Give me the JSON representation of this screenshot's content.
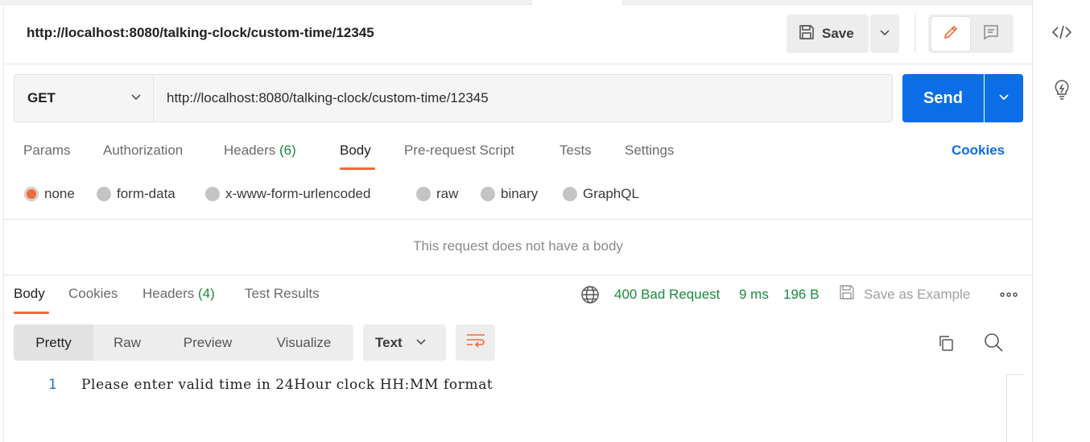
{
  "header": {
    "request_title": "http://localhost:8080/talking-clock/custom-time/12345",
    "save_label": "Save"
  },
  "url_bar": {
    "method": "GET",
    "url": "http://localhost:8080/talking-clock/custom-time/12345",
    "send_label": "Send"
  },
  "request_tabs": {
    "params": "Params",
    "authorization": "Authorization",
    "headers": "Headers",
    "headers_count": "(6)",
    "body": "Body",
    "prerequest": "Pre-request Script",
    "tests": "Tests",
    "settings": "Settings",
    "cookies": "Cookies",
    "active": "Body"
  },
  "body_types": {
    "none": "none",
    "form_data": "form-data",
    "urlencoded": "x-www-form-urlencoded",
    "raw": "raw",
    "binary": "binary",
    "graphql": "GraphQL",
    "selected": "none"
  },
  "no_body_message": "This request does not have a body",
  "response_tabs": {
    "body": "Body",
    "cookies": "Cookies",
    "headers": "Headers",
    "headers_count": "(4)",
    "test_results": "Test Results"
  },
  "response_status": {
    "status": "400 Bad Request",
    "time": "9 ms",
    "size": "196 B",
    "save_example": "Save as Example"
  },
  "view_modes": {
    "pretty": "Pretty",
    "raw": "Raw",
    "preview": "Preview",
    "visualize": "Visualize",
    "format": "Text"
  },
  "response_body": {
    "lines": [
      {
        "number": "1",
        "text": "Please enter valid time in 24Hour clock HH:MM format"
      }
    ]
  },
  "colors": {
    "accent_orange": "#f26b3a",
    "send_blue": "#0b6ee6",
    "status_green": "#1c8a3e"
  }
}
